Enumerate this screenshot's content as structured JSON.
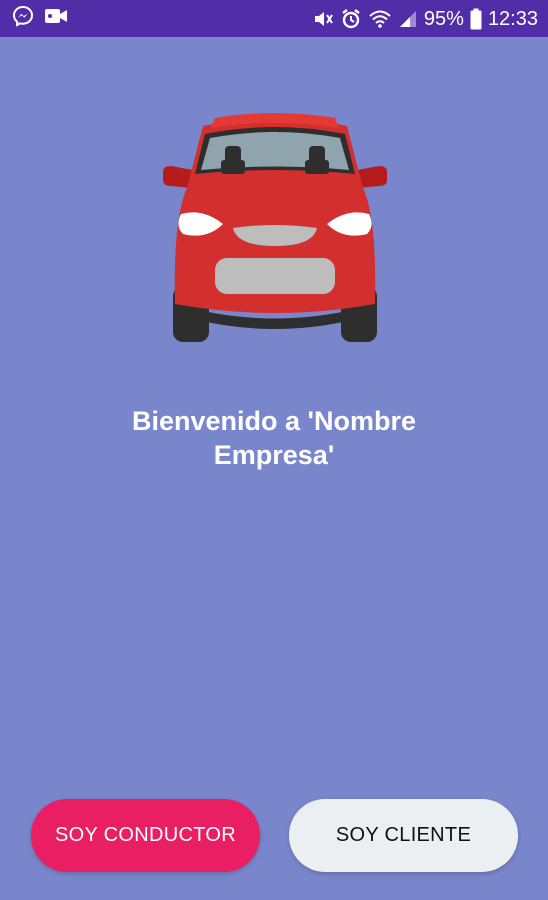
{
  "status_bar": {
    "icons_left": [
      "messenger-icon",
      "video-camera-icon"
    ],
    "icons_right": [
      "mute-vibrate-icon",
      "alarm-icon",
      "wifi-icon",
      "signal-icon",
      "battery-icon"
    ],
    "battery_percent": "95%",
    "time": "12:33",
    "background_color": "#512da8"
  },
  "main": {
    "background_color": "#7986cb",
    "illustration": "red-car-icon",
    "welcome_text": "Bienvenido a 'Nombre Empresa'"
  },
  "buttons": {
    "driver_label": "SOY CONDUCTOR",
    "driver_color": "#e91e63",
    "client_label": "SOY CLIENTE",
    "client_color": "#eceff1"
  }
}
